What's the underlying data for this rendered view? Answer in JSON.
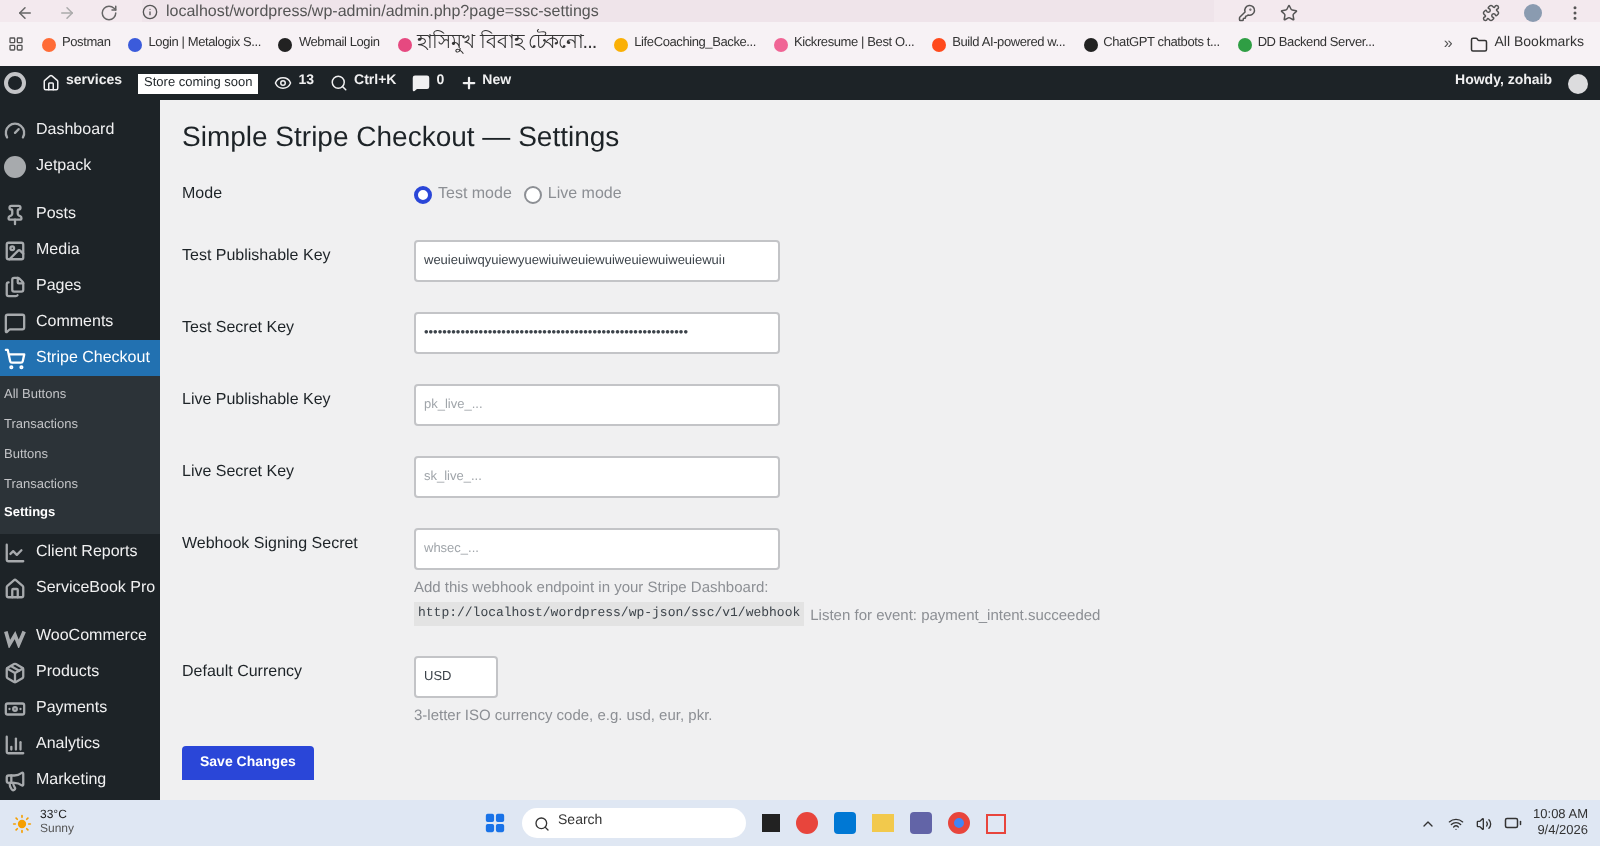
{
  "browser": {
    "url": "localhost/wordpress/wp-admin/admin.php?page=ssc-settings",
    "bookmarks": [
      {
        "label": "Postman",
        "color": "#ff6c37"
      },
      {
        "label": "Login | Metalogix S...",
        "color": "#3b5bdb"
      },
      {
        "label": "Webmail Login",
        "color": "#222222"
      },
      {
        "label": "হাসিমুখ বিবাহ টেকনো...",
        "color": "#e64980"
      },
      {
        "label": "LifeCoaching_Backe...",
        "color": "#fab005"
      },
      {
        "label": "Kickresume | Best O...",
        "color": "#f06595"
      },
      {
        "label": "Build AI-powered w...",
        "color": "#ff4a1c"
      },
      {
        "label": "ChatGPT chatbots t...",
        "color": "#222222"
      },
      {
        "label": "DD Backend Server...",
        "color": "#2f9e44"
      }
    ],
    "more": "»",
    "all_bookmarks": "All Bookmarks"
  },
  "admin_bar": {
    "site": "services",
    "badge": "Store coming soon",
    "updates": "13",
    "search": "Ctrl+K",
    "comments": "0",
    "new": "New",
    "greeting": "Howdy, zohaib"
  },
  "sidebar": {
    "items": [
      {
        "label": "Dashboard",
        "selected": false
      },
      {
        "label": "Jetpack",
        "selected": false
      },
      {
        "label": "Posts",
        "selected": false
      },
      {
        "label": "Media",
        "selected": false
      },
      {
        "label": "Pages",
        "selected": false
      },
      {
        "label": "Comments",
        "selected": false
      },
      {
        "label": "Stripe Checkout",
        "selected": true,
        "children": [
          {
            "label": "All Buttons",
            "selected": false
          },
          {
            "label": "Transactions",
            "selected": false
          },
          {
            "label": "Buttons",
            "selected": false
          },
          {
            "label": "Transactions",
            "selected": false
          },
          {
            "label": "Settings",
            "selected": true
          }
        ]
      },
      {
        "label": "Client Reports",
        "selected": false
      },
      {
        "label": "ServiceBook Pro",
        "selected": false
      },
      {
        "label": "WooCommerce",
        "selected": false
      },
      {
        "label": "Products",
        "selected": false
      },
      {
        "label": "Payments",
        "selected": false
      },
      {
        "label": "Analytics",
        "selected": false
      },
      {
        "label": "Marketing",
        "selected": false
      }
    ]
  },
  "page": {
    "title": "Simple Stripe Checkout — Settings",
    "rows": [
      {
        "kind": "radio",
        "label": "Mode",
        "options": [
          {
            "label": "Test mode",
            "selected": true
          },
          {
            "label": "Live mode",
            "selected": false
          }
        ]
      },
      {
        "kind": "input",
        "label": "Test Publishable Key",
        "value": "weuieuiwqyuiewyuewiuiweuiewuiweuiewuiweuiewuiı"
      },
      {
        "kind": "input",
        "label": "Test Secret Key",
        "value": "••••••••••••••••••••••••••••••••••••••••••••••••••••••••••"
      },
      {
        "kind": "input",
        "label": "Live Publishable Key",
        "placeholder": "pk_live_..."
      },
      {
        "kind": "input",
        "label": "Live Secret Key",
        "placeholder": "sk_live_..."
      },
      {
        "kind": "input",
        "label": "Webhook Signing Secret",
        "placeholder": "whsec_...",
        "note": {
          "text": "Add this webhook endpoint in your Stripe Dashboard:",
          "endpoint": "http://localhost/wordpress/wp-json/ssc/v1/webhook",
          "event": "Listen for event: payment_intent.succeeded"
        }
      },
      {
        "kind": "short",
        "label": "Default Currency",
        "value": "USD",
        "help": "3-letter ISO currency code, e.g. usd, eur, pkr."
      }
    ],
    "save": "Save Changes"
  },
  "taskbar": {
    "temperature": "33°C",
    "weather": "Sunny",
    "search": "Search",
    "time": "10:08 AM",
    "date": "9/4/2026"
  }
}
